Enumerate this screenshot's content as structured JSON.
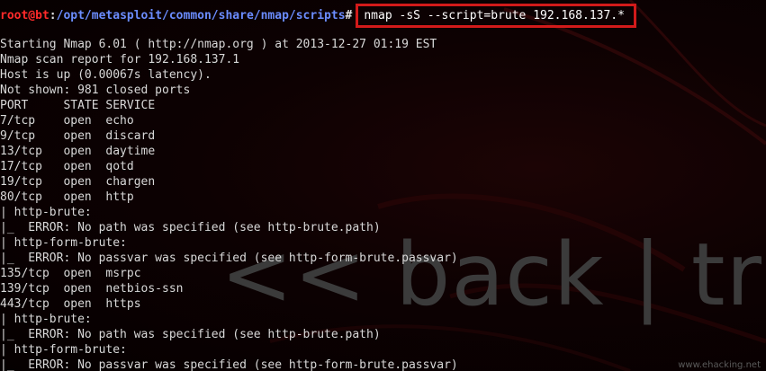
{
  "prompt": {
    "user_host": "root@bt",
    "separator": ":",
    "path": "/opt/metasploit/common/share/nmap/scripts",
    "symbol": "#",
    "command": "nmap -sS --script=brute 192.168.137.*"
  },
  "output_lines": [
    "Starting Nmap 6.01 ( http://nmap.org ) at 2013-12-27 01:19 EST",
    "Nmap scan report for 192.168.137.1",
    "Host is up (0.00067s latency).",
    "Not shown: 981 closed ports",
    "PORT     STATE SERVICE",
    "7/tcp    open  echo",
    "9/tcp    open  discard",
    "13/tcp   open  daytime",
    "17/tcp   open  qotd",
    "19/tcp   open  chargen",
    "80/tcp   open  http",
    "| http-brute:",
    "|_  ERROR: No path was specified (see http-brute.path)",
    "| http-form-brute:",
    "|_  ERROR: No passvar was specified (see http-form-brute.passvar)",
    "135/tcp  open  msrpc",
    "139/tcp  open  netbios-ssn",
    "443/tcp  open  https",
    "| http-brute:",
    "|_  ERROR: No path was specified (see http-brute.path)",
    "| http-form-brute:",
    "|_  ERROR: No passvar was specified (see http-form-brute.passvar)"
  ],
  "wallpaper": {
    "brand_text": "<< back | trac",
    "watermark": "www.ehacking.net"
  },
  "colors": {
    "background": "#0d0102",
    "text": "#d8d8d8",
    "prompt_user": "#ff2a2a",
    "prompt_path": "#6b8dff",
    "highlight_box": "#d21a1a"
  }
}
